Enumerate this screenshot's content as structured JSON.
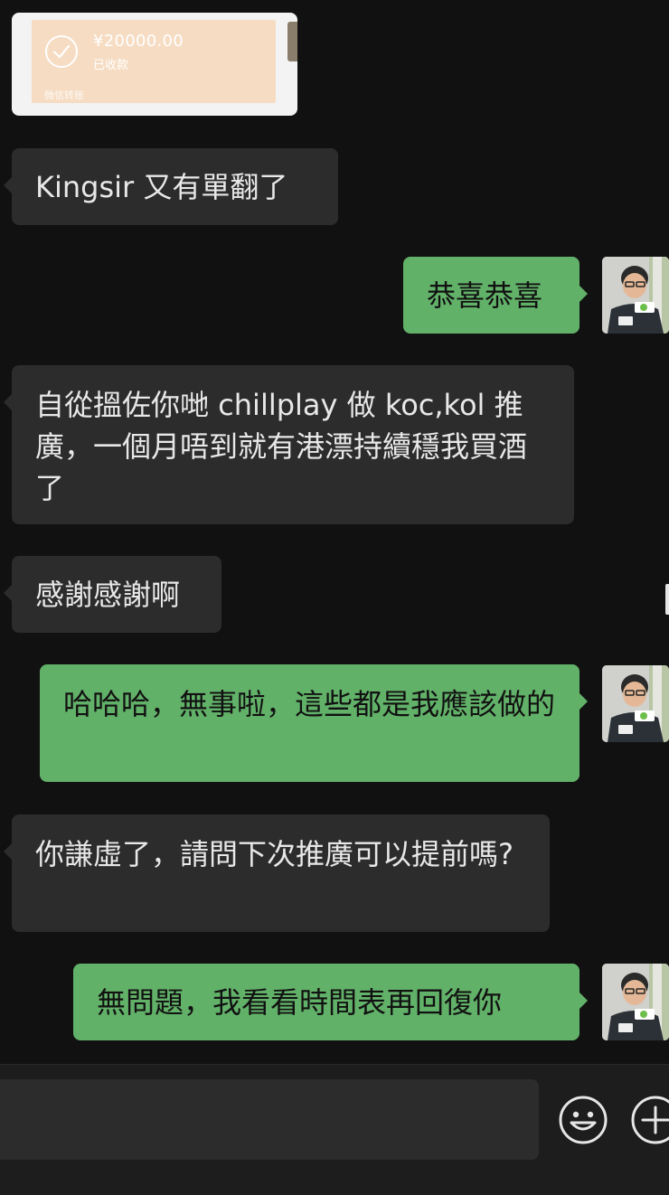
{
  "transfer": {
    "amount": "¥20000.00",
    "status": "已收款",
    "source": "微信转账"
  },
  "messages": [
    {
      "side": "left",
      "text": "Kingsir 又有單翻了"
    },
    {
      "side": "right",
      "text": "恭喜恭喜"
    },
    {
      "side": "left",
      "text": "自從搵佐你哋 chillplay 做 koc,kol 推廣，一個月唔到就有港漂持續穩我買酒了"
    },
    {
      "side": "left",
      "text": "感謝感謝啊"
    },
    {
      "side": "right",
      "text": "哈哈哈，無事啦，這些都是我應該做的"
    },
    {
      "side": "left",
      "text": "你謙虛了，請問下次推廣可以提前嗎?"
    },
    {
      "side": "right",
      "text": "無問題，我看看時間表再回復你"
    }
  ],
  "input": {
    "placeholder": ""
  },
  "icons": {
    "emoji": "smiley-face-icon",
    "plus": "plus-circle-icon"
  },
  "colors": {
    "background": "#111111",
    "incoming_bubble": "#2c2c2c",
    "outgoing_bubble": "#62b169",
    "transfer_card": "#f6dcc2"
  }
}
